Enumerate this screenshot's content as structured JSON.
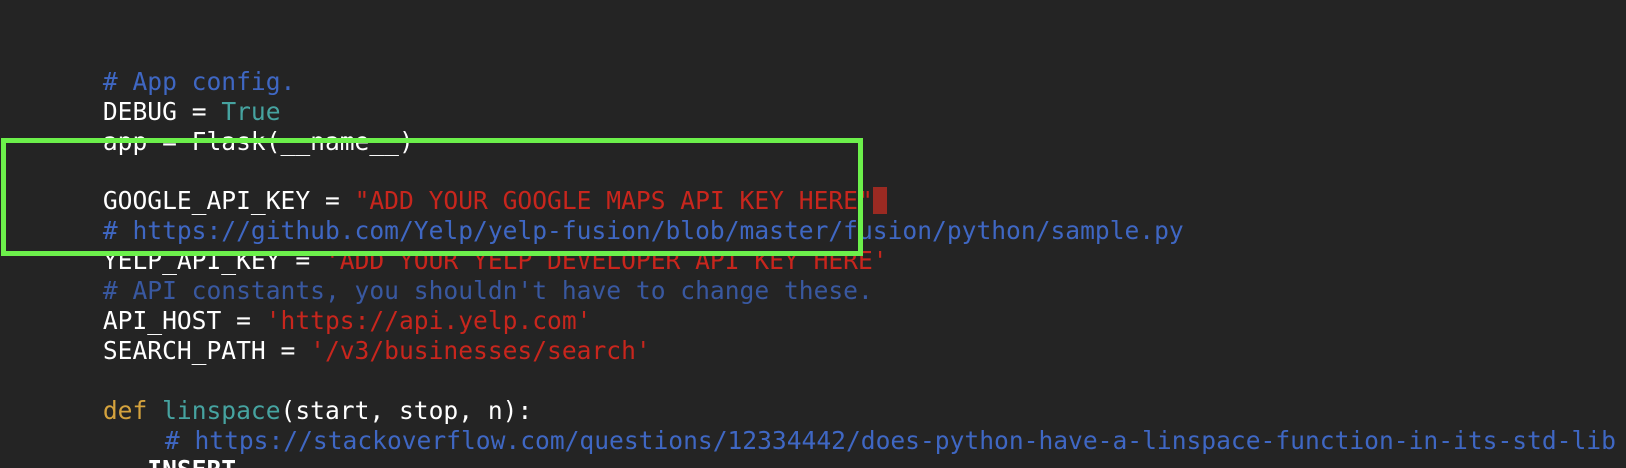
{
  "editor": {
    "lines": [
      {
        "text": "# App config."
      },
      {
        "var": "DEBUG",
        "op": " = ",
        "value": "True"
      },
      {
        "text": "app = Flask(__name__)"
      },
      {
        "text": ""
      },
      {
        "var": "GOOGLE_API_KEY",
        "op": " = ",
        "value": "\"ADD YOUR GOOGLE MAPS API KEY HERE\""
      },
      {
        "text": "# https://github.com/Yelp/yelp-fusion/blob/master/fusion/python/sample.py"
      },
      {
        "var": "YELP_API_KEY",
        "op": " = ",
        "value": "'ADD YOUR YELP DEVELOPER API KEY HERE'"
      },
      {
        "text": "# API constants, you shouldn't have to change these."
      },
      {
        "var": "API_HOST",
        "op": " = ",
        "value": "'https://api.yelp.com'"
      },
      {
        "var": "SEARCH_PATH",
        "op": " = ",
        "value": "'/v3/businesses/search'"
      },
      {
        "text": ""
      },
      {
        "keyword": "def",
        "name": "linspace",
        "args": "(start, stop, n):"
      },
      {
        "text": "# https://stackoverflow.com/questions/12334442/does-python-have-a-linspace-function-in-its-std-lib"
      }
    ],
    "mode": "-- INSERT --"
  },
  "colors": {
    "background": "#242424",
    "comment": "#3f67c3",
    "constant": "#46a3a0",
    "string": "#c8261d",
    "keyword": "#d4a23d",
    "cursor": "#9a2a22",
    "highlight_box": "#6cf04b"
  }
}
